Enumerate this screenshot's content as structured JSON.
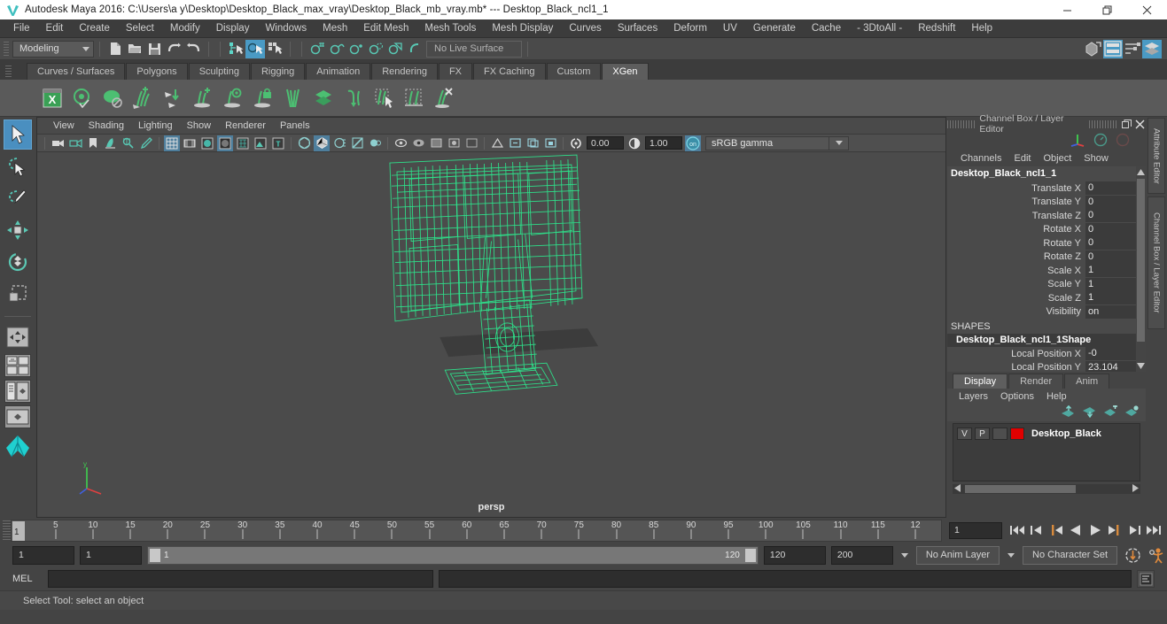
{
  "window": {
    "title": "Autodesk Maya 2016: C:\\Users\\a y\\Desktop\\Desktop_Black_max_vray\\Desktop_Black_mb_vray.mb*  ---  Desktop_Black_ncl1_1",
    "minimize": "minimize-button",
    "restore": "restore-button",
    "close": "close-button"
  },
  "menubar": {
    "items": [
      {
        "label": "File"
      },
      {
        "label": "Edit"
      },
      {
        "label": "Create"
      },
      {
        "label": "Select"
      },
      {
        "label": "Modify"
      },
      {
        "label": "Display"
      },
      {
        "label": "Windows"
      },
      {
        "label": "Mesh"
      },
      {
        "label": "Edit Mesh"
      },
      {
        "label": "Mesh Tools"
      },
      {
        "label": "Mesh Display"
      },
      {
        "label": "Curves"
      },
      {
        "label": "Surfaces"
      },
      {
        "label": "Deform"
      },
      {
        "label": "UV"
      },
      {
        "label": "Generate"
      },
      {
        "label": "Cache"
      },
      {
        "label": "- 3DtoAll -"
      },
      {
        "label": "Redshift"
      },
      {
        "label": "Help"
      }
    ]
  },
  "statusbar": {
    "mode": "Modeling",
    "live_surface": "No Live Surface"
  },
  "shelf": {
    "tabs": [
      {
        "label": "Curves / Surfaces",
        "active": false
      },
      {
        "label": "Polygons",
        "active": false
      },
      {
        "label": "Sculpting",
        "active": false
      },
      {
        "label": "Rigging",
        "active": false
      },
      {
        "label": "Animation",
        "active": false
      },
      {
        "label": "Rendering",
        "active": false
      },
      {
        "label": "FX",
        "active": false
      },
      {
        "label": "FX Caching",
        "active": false
      },
      {
        "label": "Custom",
        "active": false
      },
      {
        "label": "XGen",
        "active": true
      }
    ],
    "icons": [
      "xgen-window-icon",
      "xgen-preview-icon",
      "xgen-disable-preview-icon",
      "xgen-add-guides-icon",
      "xgen-move-guides-icon",
      "xgen-add-description-icon",
      "xgen-preview-description-icon",
      "xgen-lock-description-icon",
      "xgen-part-guides-icon",
      "xgen-layers-icon",
      "xgen-bend-guides-icon",
      "xgen-select-primitives-icon",
      "xgen-region-mask-icon",
      "xgen-delete-guides-icon"
    ]
  },
  "toolbox": {
    "tools": [
      {
        "name": "select-tool",
        "active": true
      },
      {
        "name": "lasso-select-tool",
        "active": false
      },
      {
        "name": "paint-select-tool",
        "active": false
      },
      {
        "name": "move-tool",
        "active": false
      },
      {
        "name": "rotate-tool",
        "active": false
      },
      {
        "name": "scale-tool",
        "active": false
      },
      {
        "name": "last-tool-used",
        "active": false
      }
    ],
    "layouts": [
      "single-perspective-layout",
      "four-view-layout",
      "outliner-persp-layout",
      "persp-graph-layout"
    ]
  },
  "viewport": {
    "menus": [
      {
        "label": "View"
      },
      {
        "label": "Shading"
      },
      {
        "label": "Lighting"
      },
      {
        "label": "Show"
      },
      {
        "label": "Renderer"
      },
      {
        "label": "Panels"
      }
    ],
    "exposure": "0.00",
    "gamma_value": "1.00",
    "color_management": "sRGB gamma",
    "camera_label": "persp",
    "wireframe_color": "#2ee08a",
    "background_color": "#4b4b4b",
    "object_name": "Desktop_Black"
  },
  "channelbox": {
    "panel_title": "Channel Box / Layer Editor",
    "menus": [
      {
        "label": "Channels"
      },
      {
        "label": "Edit"
      },
      {
        "label": "Object"
      },
      {
        "label": "Show"
      }
    ],
    "node_name": "Desktop_Black_ncl1_1",
    "channels": [
      {
        "label": "Translate X",
        "value": "0"
      },
      {
        "label": "Translate Y",
        "value": "0"
      },
      {
        "label": "Translate Z",
        "value": "0"
      },
      {
        "label": "Rotate X",
        "value": "0"
      },
      {
        "label": "Rotate Y",
        "value": "0"
      },
      {
        "label": "Rotate Z",
        "value": "0"
      },
      {
        "label": "Scale X",
        "value": "1"
      },
      {
        "label": "Scale Y",
        "value": "1"
      },
      {
        "label": "Scale Z",
        "value": "1"
      },
      {
        "label": "Visibility",
        "value": "on"
      }
    ],
    "shapes_header": "SHAPES",
    "shape_name": "Desktop_Black_ncl1_1Shape",
    "shape_channels": [
      {
        "label": "Local Position X",
        "value": "-0"
      },
      {
        "label": "Local Position Y",
        "value": "23.104"
      }
    ]
  },
  "layereditor": {
    "tabs": [
      {
        "label": "Display",
        "active": true
      },
      {
        "label": "Render",
        "active": false
      },
      {
        "label": "Anim",
        "active": false
      }
    ],
    "menus": [
      {
        "label": "Layers"
      },
      {
        "label": "Options"
      },
      {
        "label": "Help"
      }
    ],
    "icons": [
      "move-layer-up-icon",
      "move-layer-down-icon",
      "new-layer-icon",
      "new-layer-from-selected-icon"
    ],
    "layers": [
      {
        "visibility": "V",
        "playback": "P",
        "state": "",
        "color": "#e00000",
        "name": "Desktop_Black"
      }
    ]
  },
  "attributeeditor": {
    "tabs": [
      {
        "label": "Attribute Editor"
      },
      {
        "label": "Channel Box / Layer Editor"
      }
    ]
  },
  "timeline": {
    "current_frame": "1",
    "tick_labels": [
      "5",
      "10",
      "15",
      "20",
      "25",
      "30",
      "35",
      "40",
      "45",
      "50",
      "55",
      "60",
      "65",
      "70",
      "75",
      "80",
      "85",
      "90",
      "95",
      "100",
      "105",
      "110",
      "115",
      "12"
    ],
    "frame_field": "1",
    "playback_buttons": [
      "go-to-start-icon",
      "step-back-keyframe-icon",
      "step-back-frame-icon",
      "play-backwards-icon",
      "play-forwards-icon",
      "step-forward-frame-icon",
      "step-forward-keyframe-icon",
      "go-to-end-icon"
    ]
  },
  "rangeslider": {
    "anim_start": "1",
    "range_start": "1",
    "bar_start_label": "1",
    "bar_end_label": "120",
    "range_end": "120",
    "anim_end": "200",
    "anim_layer": "No Anim Layer",
    "character_set": "No Character Set",
    "auto_key": "auto-keyframe-toggle",
    "anim_prefs": "animation-preferences-icon"
  },
  "commandline": {
    "language": "MEL",
    "input_value": "",
    "output_value": "",
    "script_editor_button": "script-editor-icon"
  },
  "helpline": {
    "message": "Select Tool: select an object"
  }
}
